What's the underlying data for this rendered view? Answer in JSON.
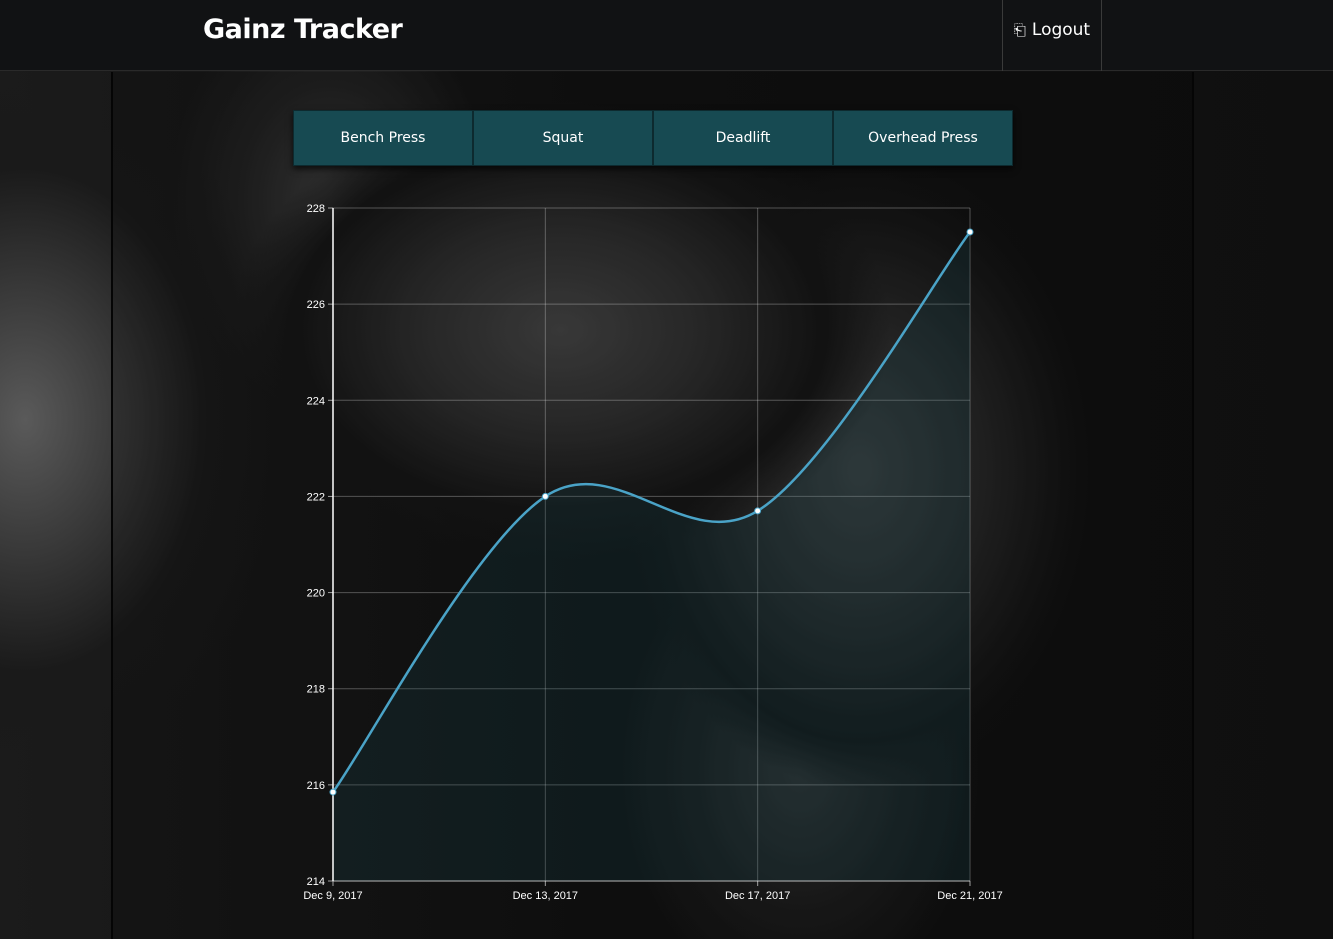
{
  "navbar": {
    "brand": "Gainz Tracker",
    "logout_label": "Logout",
    "logout_icon": "logout-icon"
  },
  "tabs": [
    {
      "label": "Bench Press"
    },
    {
      "label": "Squat"
    },
    {
      "label": "Deadlift"
    },
    {
      "label": "Overhead Press"
    }
  ],
  "colors": {
    "navbar_bg": "#111214",
    "tab_bg": "#174a52",
    "line": "#4aa3c7",
    "fill": "rgba(23,74,82,0.22)"
  },
  "chart_data": {
    "type": "line",
    "title": "",
    "xlabel": "",
    "ylabel": "",
    "x": [
      "Dec 9, 2017",
      "Dec 13, 2017",
      "Dec 17, 2017",
      "Dec 21, 2017"
    ],
    "series": [
      {
        "values": [
          215.85,
          222.0,
          221.7,
          227.5
        ]
      }
    ],
    "ylim": [
      214,
      228
    ],
    "yticks": [
      "214",
      "216",
      "218",
      "220",
      "222",
      "224",
      "226",
      "228"
    ],
    "grid": true,
    "curve": "smooth",
    "area_fill": true
  }
}
